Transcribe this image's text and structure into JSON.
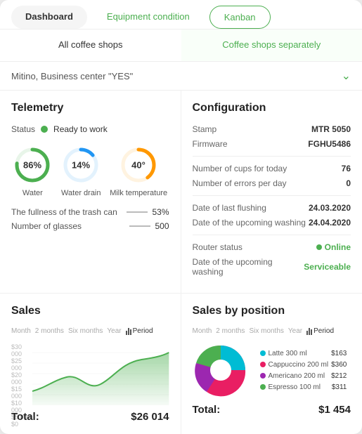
{
  "nav": {
    "tabs": [
      {
        "id": "dashboard",
        "label": "Dashboard",
        "state": "active"
      },
      {
        "id": "equipment",
        "label": "Equipment condition",
        "state": "green"
      },
      {
        "id": "kanban",
        "label": "Kanban",
        "state": "green-outline"
      }
    ]
  },
  "shopTabs": {
    "left": "All coffee shops",
    "right": "Coffee shops separately"
  },
  "location": "Mitino, Business center \"YES\"",
  "telemetry": {
    "title": "Telemetry",
    "statusLabel": "Status",
    "statusValue": "Ready to work",
    "gauges": [
      {
        "id": "water",
        "label": "Water",
        "value": "86%",
        "pct": 86,
        "color": "#4CAF50",
        "trackColor": "#e8f5e9"
      },
      {
        "id": "water-drain",
        "label": "Water drain",
        "value": "14%",
        "pct": 14,
        "color": "#2196F3",
        "trackColor": "#e3f2fd"
      },
      {
        "id": "milk-temp",
        "label": "Milk temperature",
        "value": "40°",
        "pct": 40,
        "color": "#FF9800",
        "trackColor": "#fff3e0"
      }
    ],
    "metrics": [
      {
        "label": "The fullness of the trash can",
        "value": "53%"
      },
      {
        "label": "Number of glasses",
        "value": "500"
      }
    ]
  },
  "configuration": {
    "title": "Configuration",
    "rows": [
      {
        "label": "Stamp",
        "value": "MTR 5050",
        "type": "text"
      },
      {
        "label": "Firmware",
        "value": "FGHU5486",
        "type": "text"
      }
    ],
    "cups": [
      {
        "label": "Number of cups for today",
        "value": "76"
      },
      {
        "label": "Number of errors per day",
        "value": "0"
      }
    ],
    "dates": [
      {
        "label": "Date of last flushing",
        "value": "24.03.2020"
      },
      {
        "label": "Date of the upcoming washing",
        "value": "24.04.2020"
      }
    ],
    "status": [
      {
        "label": "Router status",
        "value": "Online",
        "type": "online"
      },
      {
        "label": "Date of the upcoming washing",
        "value": "Serviceable",
        "type": "serviceable"
      }
    ]
  },
  "sales": {
    "title": "Sales",
    "periodTabs": [
      "Month",
      "2 months",
      "Six months",
      "Year"
    ],
    "activePeriod": "Period",
    "yLabels": [
      "$30 000",
      "$25 000",
      "$20 000",
      "$15 000",
      "$10 000",
      "$5 000",
      "$0"
    ],
    "total": "$26 014"
  },
  "salesByPosition": {
    "title": "Sales by position",
    "periodTabs": [
      "Month",
      "2 months",
      "Six months",
      "Year"
    ],
    "activePeriod": "Period",
    "items": [
      {
        "name": "Latte 300 ml",
        "color": "#00BCD4",
        "price": "$163"
      },
      {
        "name": "Cappuccino 200 ml",
        "color": "#E91E63",
        "price": "$360"
      },
      {
        "name": "Americano 200 ml",
        "color": "#9C27B0",
        "price": "$212"
      },
      {
        "name": "Espresso 100 ml",
        "color": "#4CAF50",
        "price": "$311"
      }
    ],
    "total": "$1 454"
  }
}
